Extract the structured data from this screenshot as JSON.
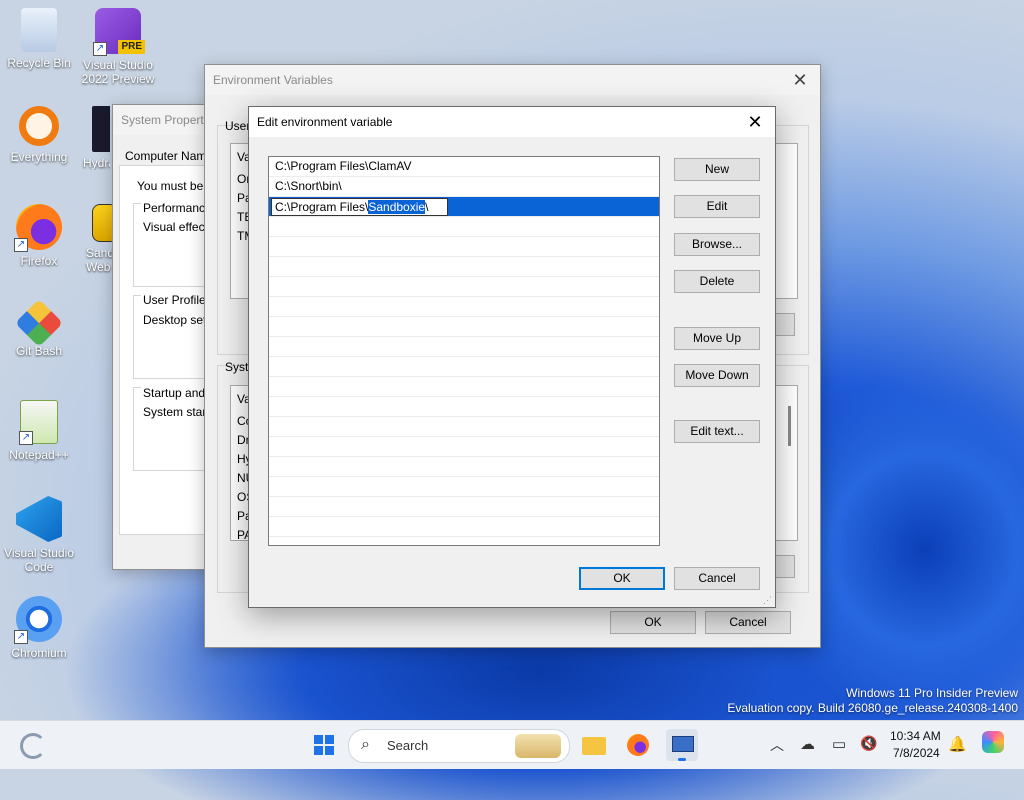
{
  "desktop": {
    "icons": [
      {
        "label": "Recycle Bin"
      },
      {
        "label": "Visual Studio 2022 Preview",
        "badge": "PRE"
      },
      {
        "label": "Everything"
      },
      {
        "label": "Hydra"
      },
      {
        "label": "Firefox"
      },
      {
        "label": "Sandboxie Web"
      },
      {
        "label": "Git Bash"
      },
      {
        "label": "Notepad++"
      },
      {
        "label": "Visual Studio Code"
      },
      {
        "label": "Chromium"
      }
    ]
  },
  "system_properties": {
    "title": "System Propert",
    "computer_name_tab": "Computer Name",
    "must_be": "You must be lo",
    "performance": "Performance",
    "visual_effects": "Visual effects",
    "user_profiles": "User Profiles",
    "desktop_settings": "Desktop setti",
    "startup": "Startup and R",
    "system_startup": "System startu"
  },
  "env_vars": {
    "title": "Environment Variables",
    "user_section": "User",
    "user_rows": [
      "Va",
      "On",
      "Pa",
      "TE",
      "TM"
    ],
    "system_section": "Syste",
    "system_rows": [
      "Va",
      "Co",
      "Dr",
      "Hy",
      "NU",
      "OS",
      "Pa",
      "PA"
    ],
    "ok": "OK",
    "cancel": "Cancel"
  },
  "edit_dialog": {
    "title": "Edit environment variable",
    "entries": [
      "C:\\Program Files\\ClamAV",
      "C:\\Snort\\bin\\"
    ],
    "edit_prefix": "C:\\Program Files\\",
    "edit_selected": "Sandboxie",
    "edit_suffix": "\\",
    "buttons": {
      "new": "New",
      "edit": "Edit",
      "browse": "Browse...",
      "delete": "Delete",
      "move_up": "Move Up",
      "move_down": "Move Down",
      "edit_text": "Edit text...",
      "ok": "OK",
      "cancel": "Cancel"
    }
  },
  "watermark": {
    "line1": "Windows 11 Pro Insider Preview",
    "line2": "Evaluation copy. Build 26080.ge_release.240308-1400"
  },
  "taskbar": {
    "search_placeholder": "Search",
    "time": "10:34 AM",
    "date": "7/8/2024"
  }
}
